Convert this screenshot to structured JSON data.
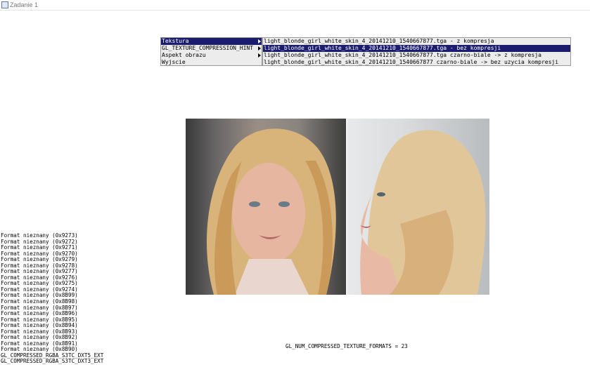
{
  "window": {
    "title": "Zadanie 1",
    "icon": "app-window-icon"
  },
  "menu": {
    "items": [
      {
        "label": "Tekstura",
        "selected": true,
        "has_submenu": true
      },
      {
        "label": "GL_TEXTURE_COMPRESSION_HINT",
        "selected": false,
        "has_submenu": true
      },
      {
        "label": "Aspekt obrazu",
        "selected": false,
        "has_submenu": true
      },
      {
        "label": "Wyjscie",
        "selected": false,
        "has_submenu": false
      }
    ],
    "selected_color": "#1c1c6e"
  },
  "submenu": {
    "items": [
      {
        "label": "light_blonde_girl_white_skin_4_20141210_1540667877.tga - z kompresja",
        "selected": false
      },
      {
        "label": "light_blonde_girl_white_skin_4_20141210_1540667877.tga  - bez kompresji",
        "selected": true
      },
      {
        "label": "light_blonde_girl_white_skin_4_20141210_1540667877.tga czarno-biale -> z kompresja",
        "selected": false
      },
      {
        "label": "light_blonde_girl_white_skin_4_20141210_1540667877 czarno-biale -> bez uzycia kompresji",
        "selected": false
      }
    ]
  },
  "formats_list": [
    "Format nieznany (0x9273)",
    "Format nieznany (0x9272)",
    "Format nieznany (0x9271)",
    "Format nieznany (0x9270)",
    "Format nieznany (0x9279)",
    "Format nieznany (0x9278)",
    "Format nieznany (0x9277)",
    "Format nieznany (0x9276)",
    "Format nieznany (0x9275)",
    "Format nieznany (0x9274)",
    "Format nieznany (0x8B99)",
    "Format nieznany (0x8B98)",
    "Format nieznany (0x8B97)",
    "Format nieznany (0x8B96)",
    "Format nieznany (0x8B95)",
    "Format nieznany (0x8B94)",
    "Format nieznany (0x8B93)",
    "Format nieznany (0x8B92)",
    "Format nieznany (0x8B91)",
    "Format nieznany (0x8B90)",
    "GL_COMPRESSED_RGBA_S3TC_DXT5_EXT",
    "GL_COMPRESSED_RGBA_S3TC_DXT3_EXT"
  ],
  "num_formats_text": "GL_NUM_COMPRESSED_TEXTURE_FORMATS = 23"
}
